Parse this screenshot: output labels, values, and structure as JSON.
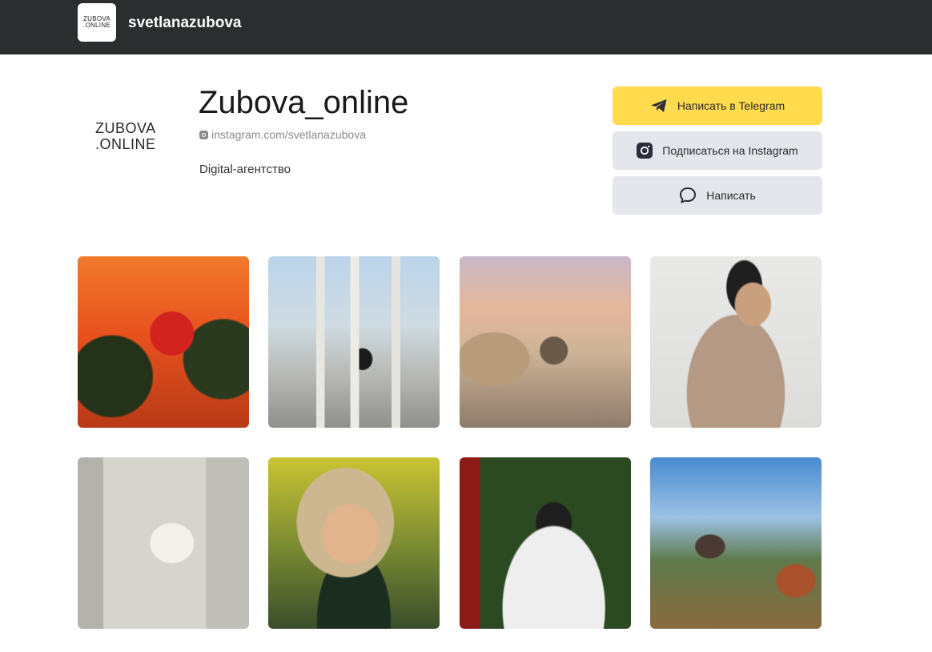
{
  "topbar": {
    "logo_line1": "ZUBOVA",
    "logo_line2": ".ONLINE",
    "brand": "svetlanazubova"
  },
  "profile": {
    "logo_line1": "ZUBOVA",
    "logo_line2": ".ONLINE",
    "name": "Zubova_online",
    "link": "instagram.com/svetlanazubova",
    "description": "Digital-агентство"
  },
  "actions": {
    "telegram_label": "Написать в Telegram",
    "instagram_label": "Подписаться на Instagram",
    "write_label": "Написать"
  },
  "icons": {
    "telegram": "telegram-icon",
    "instagram": "instagram-icon",
    "chat": "chat-bubble-icon"
  },
  "colors": {
    "topbar": "#2b2d2e",
    "telegram_button": "#ffdb4d",
    "secondary_button": "#e4e6ec"
  }
}
